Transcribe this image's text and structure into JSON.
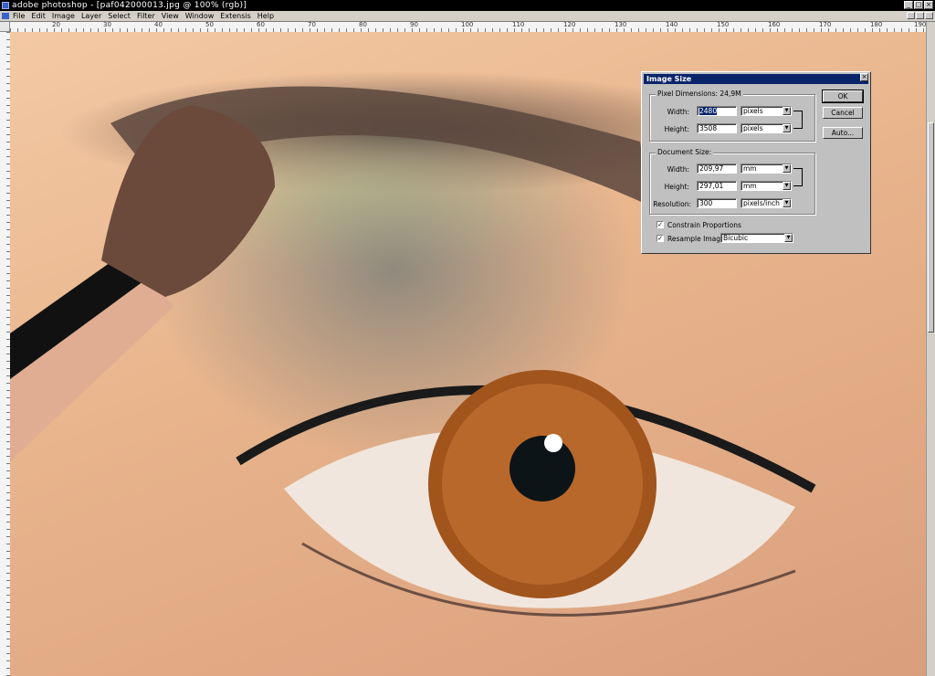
{
  "app": {
    "title": "adobe photoshop - [paf042000013.jpg @ 100% (rgb)]",
    "window_buttons": [
      "_",
      "□",
      "×"
    ]
  },
  "menu": [
    "File",
    "Edit",
    "Image",
    "Layer",
    "Select",
    "Filter",
    "View",
    "Window",
    "Extensis",
    "Help"
  ],
  "ruler": {
    "ticks": [
      "20",
      "30",
      "40",
      "50",
      "60",
      "70",
      "80",
      "90",
      "100",
      "110",
      "120",
      "130",
      "140",
      "150",
      "160",
      "170",
      "180",
      "190"
    ]
  },
  "dialog": {
    "title": "Image Size",
    "close_label": "×",
    "pixel_dimensions": {
      "label": "Pixel Dimensions: 24,9M",
      "width_label": "Width:",
      "width_value": "2480",
      "width_unit": "pixels",
      "height_label": "Height:",
      "height_value": "3508",
      "height_unit": "pixels"
    },
    "document_size": {
      "label": "Document Size:",
      "width_label": "Width:",
      "width_value": "209,97",
      "width_unit": "mm",
      "height_label": "Height:",
      "height_value": "297,01",
      "height_unit": "mm",
      "resolution_label": "Resolution:",
      "resolution_value": "300",
      "resolution_unit": "pixels/inch"
    },
    "constrain": {
      "label": "Constrain Proportions",
      "checked": true
    },
    "resample": {
      "label": "Resample Image:",
      "checked": true,
      "method": "Bicubic"
    },
    "buttons": {
      "ok": "OK",
      "cancel": "Cancel",
      "auto": "Auto..."
    }
  }
}
